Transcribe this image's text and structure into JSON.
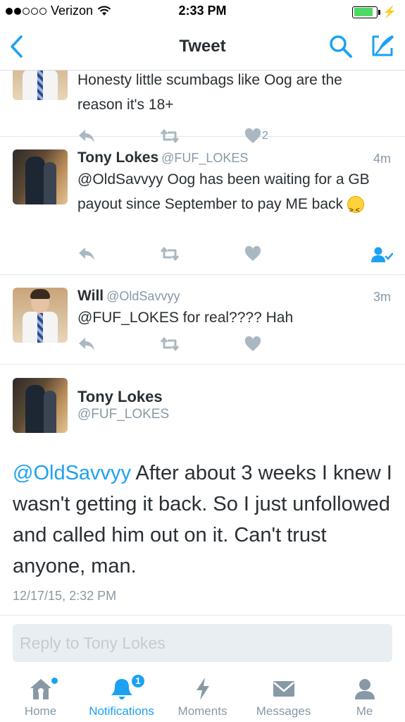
{
  "status_bar": {
    "carrier": "Verizon",
    "time": "2:33 PM",
    "signal_bars": 2,
    "battery_level": 0.85
  },
  "nav": {
    "title": "Tweet",
    "back_icon": "chevron-left-icon",
    "search_icon": "search-icon",
    "compose_icon": "compose-icon"
  },
  "tweets": [
    {
      "text": "Honesty little scumbags like Oog are the reason it's 18+",
      "like_count": "2"
    },
    {
      "name": "Tony Lokes",
      "handle": "@FUF_LOKES",
      "time": "4m",
      "text": "@OldSavvyy Oog has been waiting for a GB payout since September to pay ME back"
    },
    {
      "name": "Will",
      "handle": "@OldSavvyy",
      "time": "3m",
      "text": "@FUF_LOKES for real???? Hah"
    }
  ],
  "detail": {
    "name": "Tony Lokes",
    "handle": "@FUF_LOKES",
    "mention": "@OldSavvyy",
    "text": " After about 3 weeks I knew I wasn't getting it back. So I just unfollowed and called him out on it. Can't trust anyone, man.",
    "date": "12/17/15, 2:32 PM"
  },
  "reply": {
    "placeholder": "Reply to Tony Lokes"
  },
  "tabs": [
    {
      "label": "Home",
      "icon": "home-icon"
    },
    {
      "label": "Notifications",
      "icon": "bell-icon",
      "badge": "1"
    },
    {
      "label": "Moments",
      "icon": "lightning-icon"
    },
    {
      "label": "Messages",
      "icon": "envelope-icon"
    },
    {
      "label": "Me",
      "icon": "person-icon"
    }
  ],
  "colors": {
    "accent": "#1da1f2",
    "muted": "#8899a6",
    "text": "#292f33",
    "action_icon": "#aab8c2"
  }
}
